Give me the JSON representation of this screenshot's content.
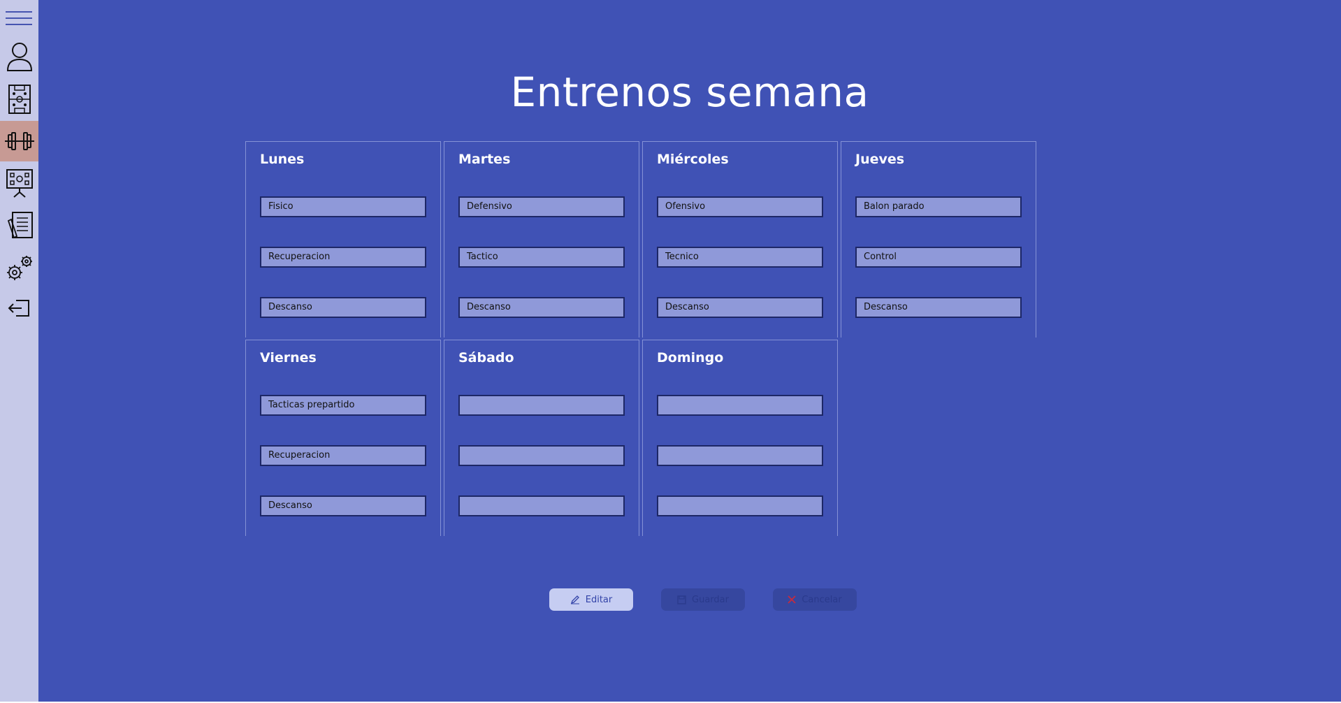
{
  "page": {
    "title": "Entrenos semana"
  },
  "colors": {
    "background": "#4052b5",
    "sidebar": "#c6c9e8",
    "active_nav": "#c79a94",
    "slot_fill": "#8f99d9",
    "slot_border": "#1d2766",
    "edit_button": "#c6cdf2",
    "disabled_button": "#36479f",
    "cancel_x": "#cc2a3a"
  },
  "sidebar": {
    "items": [
      {
        "icon": "menu-icon"
      },
      {
        "icon": "user-icon"
      },
      {
        "icon": "tactics-board-icon"
      },
      {
        "icon": "dumbbell-icon",
        "active": true
      },
      {
        "icon": "presentation-board-icon"
      },
      {
        "icon": "notes-icon"
      },
      {
        "icon": "settings-icon"
      },
      {
        "icon": "logout-icon"
      }
    ]
  },
  "days": [
    {
      "name": "Lunes",
      "slots": [
        "Fisico",
        "Recuperacion",
        "Descanso"
      ]
    },
    {
      "name": "Martes",
      "slots": [
        "Defensivo",
        "Tactico",
        "Descanso"
      ]
    },
    {
      "name": "Miércoles",
      "slots": [
        "Ofensivo",
        "Tecnico",
        "Descanso"
      ]
    },
    {
      "name": "Jueves",
      "slots": [
        "Balon parado",
        "Control",
        "Descanso"
      ]
    },
    {
      "name": "Viernes",
      "slots": [
        "Tacticas prepartido",
        "Recuperacion",
        "Descanso"
      ]
    },
    {
      "name": "Sábado",
      "slots": [
        "",
        "",
        ""
      ]
    },
    {
      "name": "Domingo",
      "slots": [
        "",
        "",
        ""
      ]
    }
  ],
  "buttons": {
    "edit": {
      "label": "Editar",
      "icon": "pen-icon",
      "enabled": true
    },
    "save": {
      "label": "Guardar",
      "icon": "save-icon",
      "enabled": false
    },
    "cancel": {
      "label": "Cancelar",
      "icon": "close-icon",
      "enabled": false
    }
  }
}
